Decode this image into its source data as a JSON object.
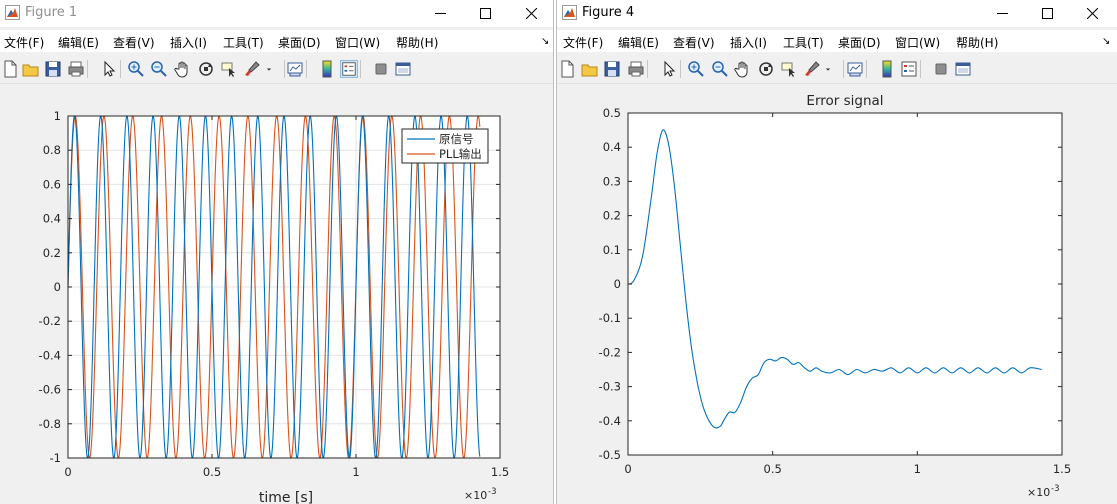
{
  "windows": [
    {
      "title": "Figure 1",
      "menu": [
        "文件(F)",
        "编辑(E)",
        "查看(V)",
        "插入(I)",
        "工具(T)",
        "桌面(D)",
        "窗口(W)",
        "帮助(H)"
      ]
    },
    {
      "title": "Figure 4",
      "menu": [
        "文件(F)",
        "编辑(E)",
        "查看(V)",
        "插入(I)",
        "工具(T)",
        "桌面(D)",
        "窗口(W)",
        "帮助(H)"
      ]
    }
  ],
  "toolbar_icons": [
    "new-file-icon",
    "open-folder-icon",
    "save-icon",
    "print-icon",
    "pointer-icon",
    "zoom-in-icon",
    "zoom-out-icon",
    "pan-hand-icon",
    "rotate-3d-icon",
    "data-cursor-icon",
    "brush-icon",
    "brush-dropdown-icon",
    "link-plot-icon",
    "colorbar-icon",
    "legend-icon",
    "hide-plot-tools-icon",
    "show-plot-tools-icon"
  ],
  "chart_data": [
    {
      "type": "line",
      "title": "",
      "xlabel": "time [s]",
      "ylabel": "",
      "x_exponent": "×10^-3",
      "xlim": [
        0,
        1.5
      ],
      "ylim": [
        -1,
        1
      ],
      "xticks": [
        "0",
        "0.5",
        "1",
        "1.5"
      ],
      "yticks": [
        "-1",
        "-0.8",
        "-0.6",
        "-0.4",
        "-0.2",
        "0",
        "0.2",
        "0.4",
        "0.6",
        "0.8",
        "1"
      ],
      "grid": true,
      "legend_position": "top-right",
      "series": [
        {
          "name": "原信号",
          "color": "#0072BD",
          "description_values": {
            "amplitude": 1,
            "frequency_khz": 11,
            "phase": "sine, starts at 0",
            "x_end": 1.43,
            "y_end": -0.06
          }
        },
        {
          "name": "PLL输出",
          "color": "#D95319",
          "description_values": {
            "amplitude": 1,
            "frequency_khz": 10,
            "phase": "starts near 0 rising",
            "x_end": 1.43
          }
        }
      ]
    },
    {
      "type": "line",
      "title": "Error signal",
      "xlabel": "",
      "ylabel": "",
      "x_exponent": "×10^-3",
      "xlim": [
        0,
        1.5
      ],
      "ylim": [
        -0.5,
        0.5
      ],
      "xticks": [
        "0",
        "0.5",
        "1",
        "1.5"
      ],
      "yticks": [
        "-0.5",
        "-0.4",
        "-0.3",
        "-0.2",
        "-0.1",
        "0",
        "0.1",
        "0.2",
        "0.3",
        "0.4",
        "0.5"
      ],
      "grid": false,
      "series": [
        {
          "color": "#0072BD",
          "x": [
            0,
            0.02,
            0.05,
            0.08,
            0.1,
            0.12,
            0.14,
            0.16,
            0.18,
            0.2,
            0.22,
            0.24,
            0.26,
            0.28,
            0.3,
            0.32,
            0.33,
            0.35,
            0.37,
            0.39,
            0.41,
            0.43,
            0.45,
            0.47,
            0.49,
            0.51,
            0.53,
            0.55,
            0.57,
            0.59,
            0.61,
            0.63,
            0.65,
            0.67,
            0.7,
            0.73,
            0.76,
            0.79,
            0.82,
            0.85,
            0.88,
            0.91,
            0.94,
            0.97,
            1.0,
            1.03,
            1.06,
            1.09,
            1.12,
            1.15,
            1.18,
            1.21,
            1.24,
            1.27,
            1.3,
            1.33,
            1.36,
            1.39,
            1.43
          ],
          "y": [
            0,
            0.01,
            0.08,
            0.25,
            0.38,
            0.45,
            0.41,
            0.29,
            0.12,
            -0.05,
            -0.19,
            -0.29,
            -0.36,
            -0.4,
            -0.42,
            -0.415,
            -0.4,
            -0.375,
            -0.375,
            -0.345,
            -0.3,
            -0.275,
            -0.265,
            -0.23,
            -0.22,
            -0.225,
            -0.215,
            -0.22,
            -0.235,
            -0.23,
            -0.245,
            -0.255,
            -0.245,
            -0.255,
            -0.26,
            -0.25,
            -0.265,
            -0.25,
            -0.26,
            -0.25,
            -0.255,
            -0.245,
            -0.26,
            -0.245,
            -0.26,
            -0.245,
            -0.26,
            -0.245,
            -0.26,
            -0.245,
            -0.26,
            -0.245,
            -0.26,
            -0.245,
            -0.26,
            -0.245,
            -0.26,
            -0.245,
            -0.25
          ]
        }
      ]
    }
  ]
}
